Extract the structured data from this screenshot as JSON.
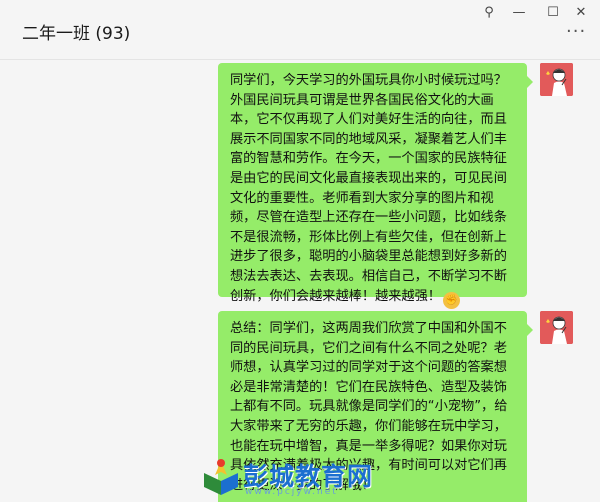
{
  "window": {
    "title": "二年一班 (93)",
    "controls": {
      "pin": "⚲",
      "minimize": "—",
      "maximize": "☐",
      "close": "✕",
      "more": "···"
    }
  },
  "messages": [
    {
      "sender": "self",
      "text": "同学们，今天学习的外国玩具你小时候玩过吗？外国民间玩具可谓是世界各国民俗文化的大画本，它不仅再现了人们对美好生活的向往，而且展示不同国家不同的地域风采，凝聚着艺人们丰富的智慧和劳作。在今天，一个国家的民族特征是由它的民间文化最直接表现出来的，可见民间文化的重要性。老师看到大家分享的图片和视频，尽管在造型上还存在一些小问题，比如线条不是很流畅，形体比例上有些欠佳，但在创新上进步了很多，聪明的小脑袋里总能想到好多新的想法去表达、去表现。相信自己，不断学习不断创新，你们会越来越棒！越来越强！",
      "emoji": "fist-emoji"
    },
    {
      "sender": "self",
      "text": "总结：同学们，这两周我们欣赏了中国和外国不同的民间玩具，它们之间有什么不同之处呢？老师想，认真学习过的同学对于这个问题的答案想必是非常清楚的！它们在民族特色、造型及装饰上都有不同。玩具就像是同学们的“小宠物”，给大家带来了无穷的乐趣，你们能够在玩中学习，也能在玩中增智，真是一举多得呢？如果你对玩具依然充满着极大的兴趣，有时间可以对它们再进行更深一步的了解哦！"
    }
  ],
  "watermark": {
    "text": "彭城教育网",
    "url": "www.pcjyw.net"
  },
  "colors": {
    "bubble": "#95ec69",
    "background": "#f5f5f5",
    "avatar": "#e25a5a",
    "watermark": "#1c6fd0"
  }
}
